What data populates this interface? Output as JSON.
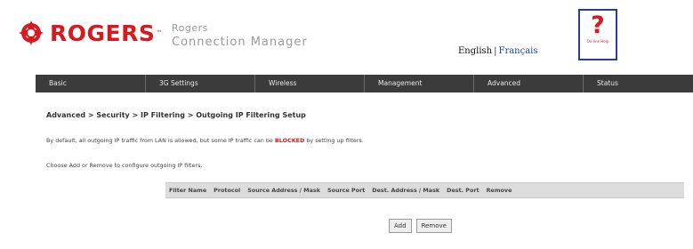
{
  "brand": {
    "logo_text": "ROGERS",
    "logo_tm": "™",
    "product_line1": "Rogers",
    "product_line2": "Connection Manager",
    "brand_color": "#d71920"
  },
  "language": {
    "english": "English",
    "separator": "|",
    "french": "Français"
  },
  "help": {
    "symbol": "?",
    "caption": "On-line Help"
  },
  "nav": {
    "items": [
      {
        "label": "Basic"
      },
      {
        "label": "3G Settings"
      },
      {
        "label": "Wireless"
      },
      {
        "label": "Management"
      },
      {
        "label": "Advanced"
      },
      {
        "label": "Status"
      }
    ],
    "bar_color": "#3b3b3b"
  },
  "page": {
    "breadcrumb": "Advanced > Security > IP Filtering > Outgoing IP Filtering Setup",
    "description_before": "By default, all outgoing IP traffic from LAN is allowed, but some IP traffic can be ",
    "description_blocked": "BLOCKED",
    "description_after": " by setting up filters.",
    "instruction": "Choose Add or Remove to configure outgoing IP filters."
  },
  "table": {
    "headers": [
      "Filter Name",
      "Protocol",
      "Source Address / Mask",
      "Source Port",
      "Dest. Address / Mask",
      "Dest. Port",
      "Remove"
    ]
  },
  "buttons": {
    "add": "Add",
    "remove": "Remove"
  }
}
